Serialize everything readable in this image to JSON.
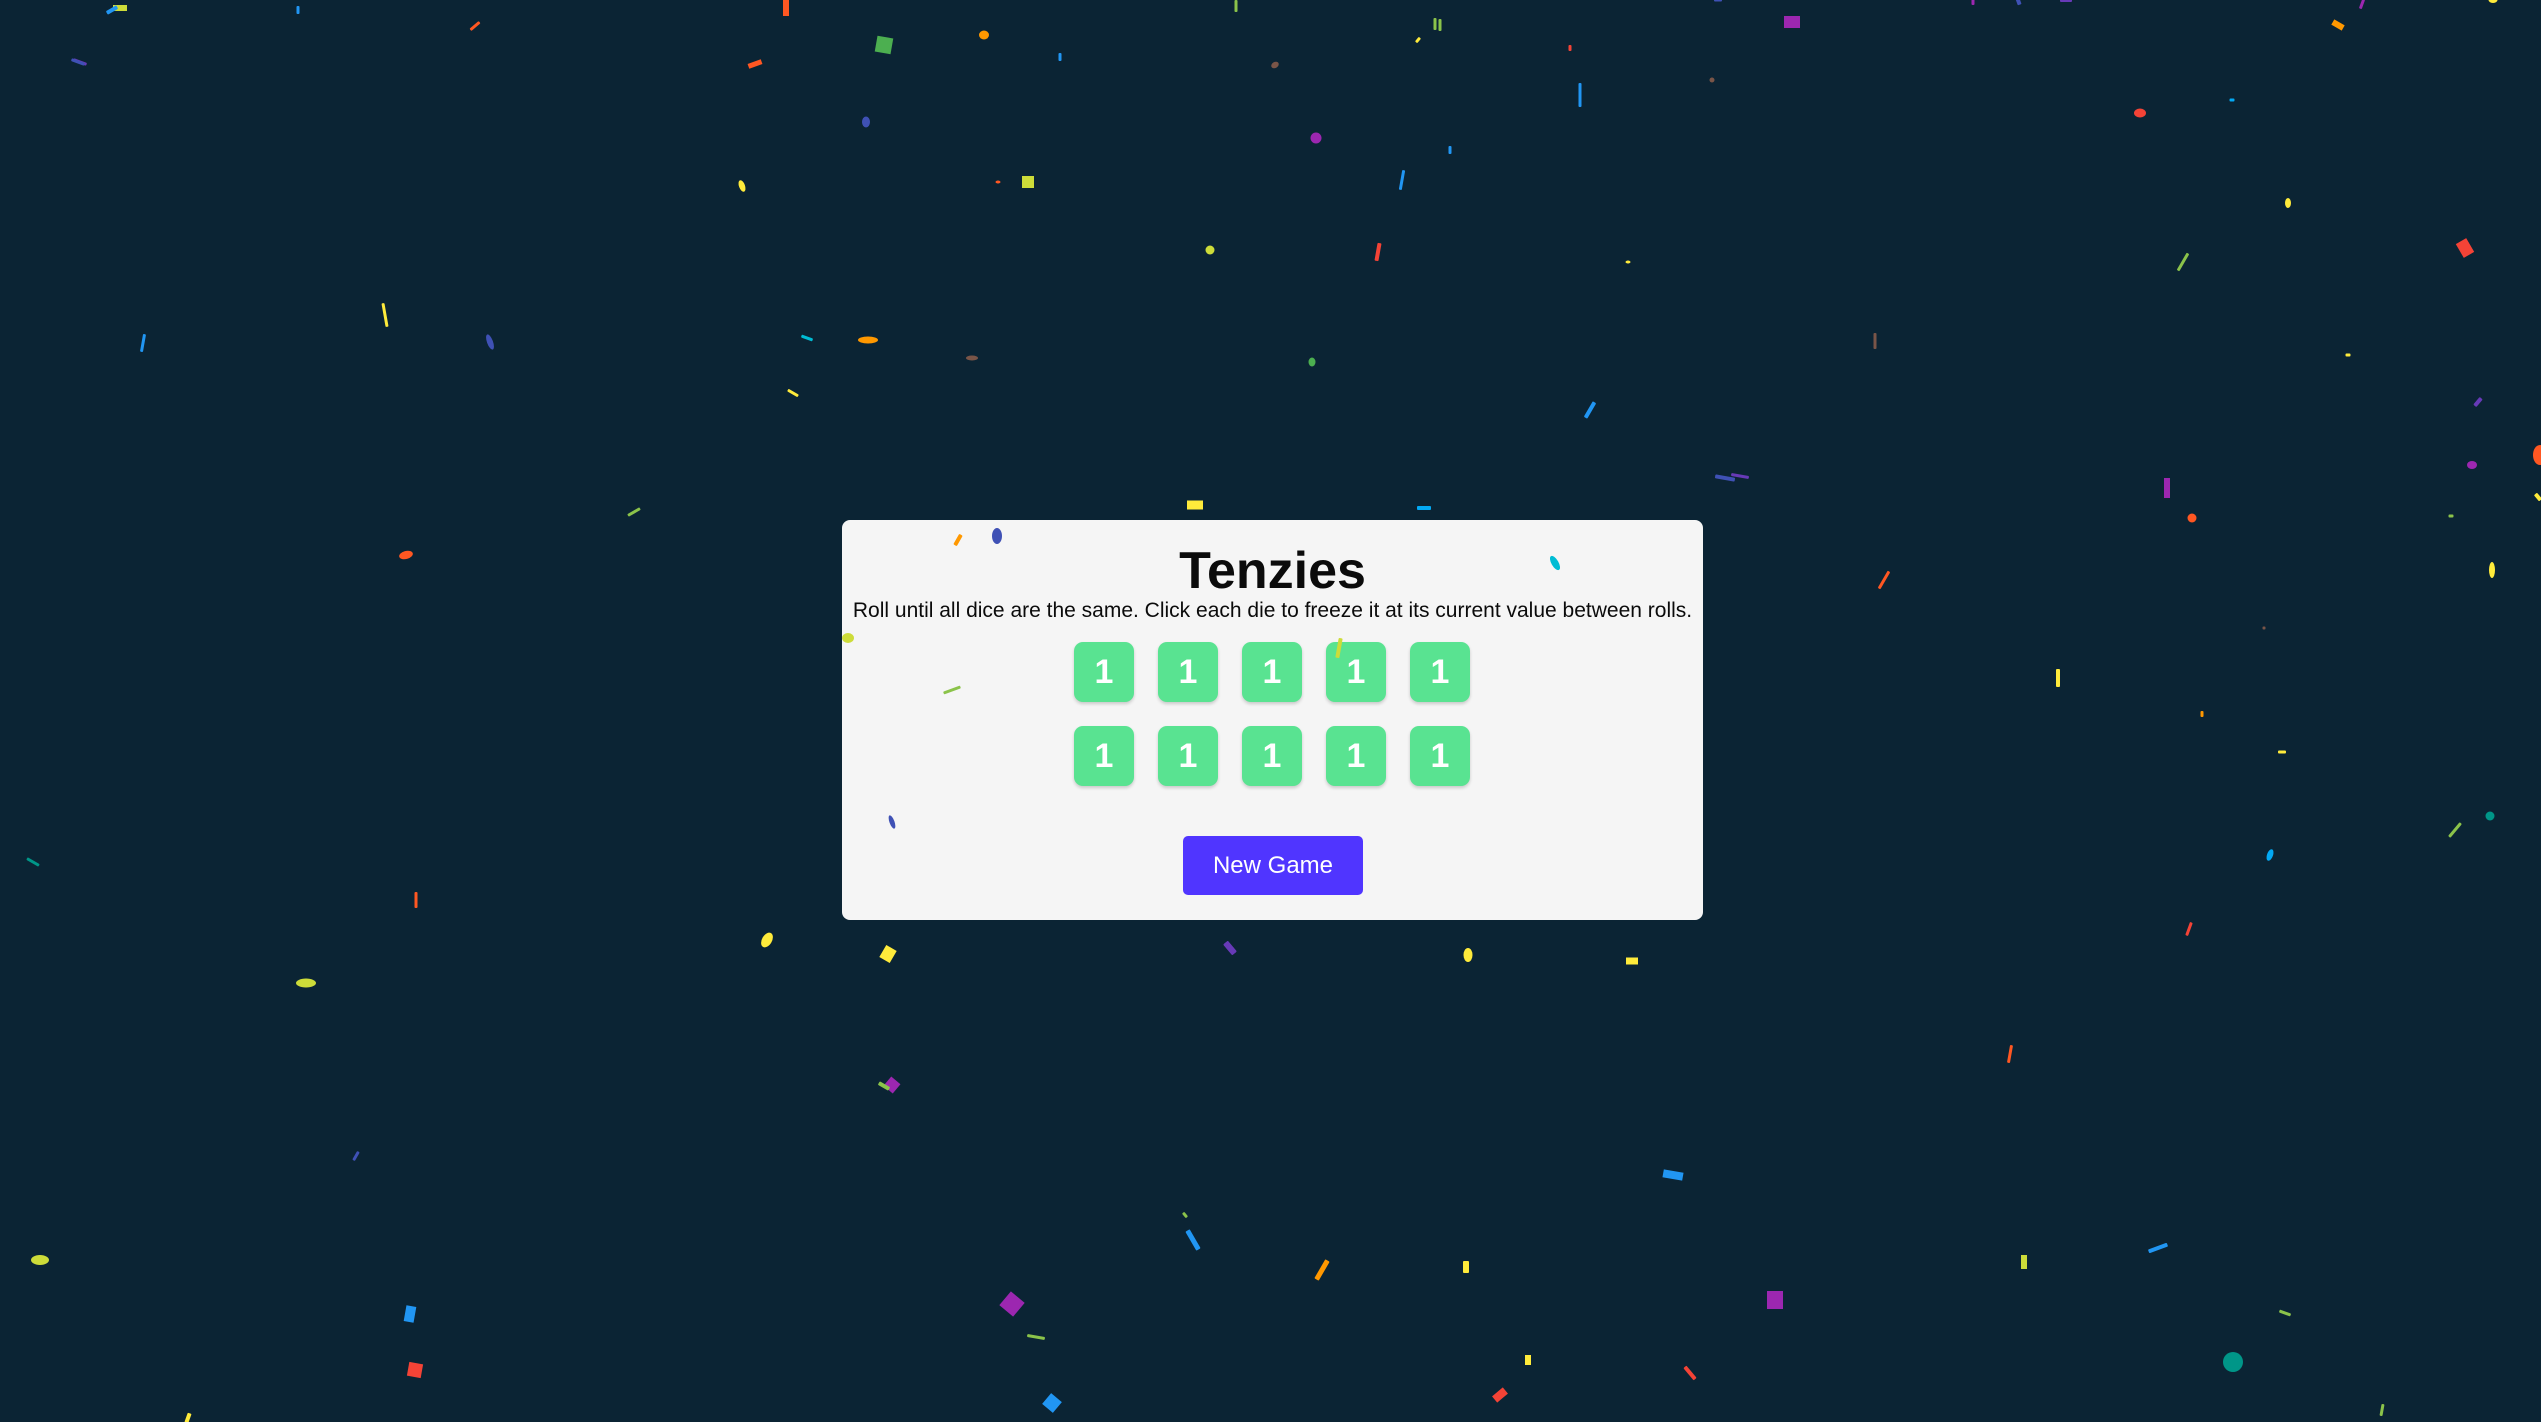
{
  "app": {
    "title": "Tenzies",
    "instructions": "Roll until all dice are the same. Click each die to freeze it at its current value between rolls."
  },
  "dice": [
    {
      "value": "1",
      "held": false
    },
    {
      "value": "1",
      "held": false
    },
    {
      "value": "1",
      "held": false
    },
    {
      "value": "1",
      "held": false
    },
    {
      "value": "1",
      "held": false
    },
    {
      "value": "1",
      "held": false
    },
    {
      "value": "1",
      "held": false
    },
    {
      "value": "1",
      "held": false
    },
    {
      "value": "1",
      "held": false
    },
    {
      "value": "1",
      "held": false
    }
  ],
  "controls": {
    "new_game_label": "New Game"
  },
  "state": {
    "won": true,
    "confetti_visible": true
  },
  "colors": {
    "background": "#0b2434",
    "card": "#f5f5f5",
    "die": "#59e391",
    "die_text": "#ffffff",
    "button": "#5035ff",
    "button_text": "#ffffff",
    "confetti": [
      "#f44336",
      "#ff9800",
      "#ffeb3b",
      "#cddc39",
      "#8bc34a",
      "#4caf50",
      "#00bcd4",
      "#03a9f4",
      "#2196f3",
      "#3f51b5",
      "#673ab7",
      "#9c27b0",
      "#ff5722",
      "#795548",
      "#009688",
      "#e91e63"
    ]
  }
}
